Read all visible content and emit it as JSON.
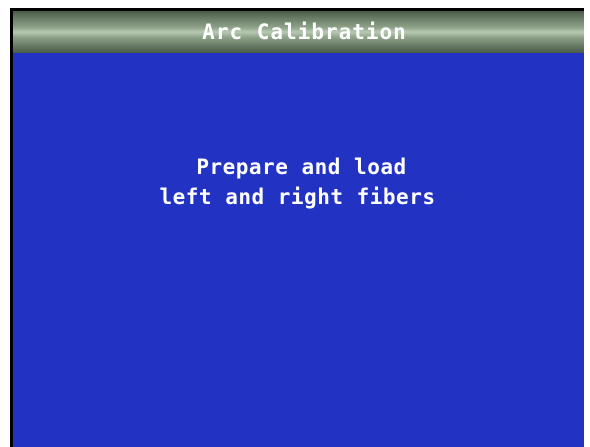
{
  "window": {
    "title": "Arc Calibration"
  },
  "message": {
    "line1": "Prepare and load",
    "line2": "left and right fibers"
  },
  "colors": {
    "screen_background": "#2233c4",
    "title_bar": "#8fa48b",
    "text": "#ffffff"
  }
}
